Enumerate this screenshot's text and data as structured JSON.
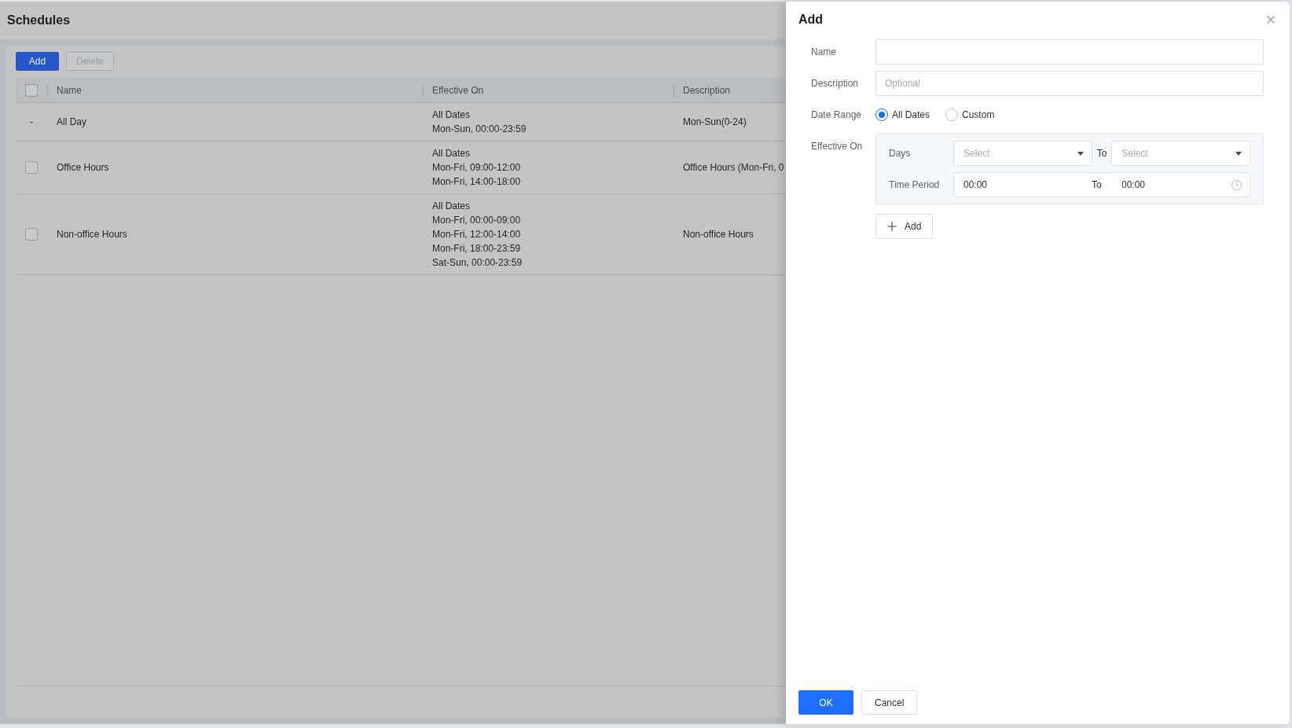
{
  "page": {
    "title": "Schedules",
    "toolbar": [
      {
        "label": "Add",
        "kind": "primary",
        "disabled": false
      },
      {
        "label": "Delete",
        "kind": "default",
        "disabled": true
      }
    ],
    "table": {
      "header_checkbox": {
        "checked": false
      },
      "columns": [
        "Name",
        "Effective On",
        "Description"
      ],
      "rows": [
        {
          "select": {
            "kind": "text",
            "text": "-"
          },
          "name": "All Day",
          "effective_on": [
            "All Dates",
            "Mon-Sun, 00:00-23:59"
          ],
          "description": "Mon-Sun(0-24)"
        },
        {
          "select": {
            "kind": "checkbox",
            "checked": false
          },
          "name": "Office Hours",
          "effective_on": [
            "All Dates",
            "Mon-Fri, 09:00-12:00",
            "Mon-Fri, 14:00-18:00"
          ],
          "description": "Office Hours (Mon-Fri, 0"
        },
        {
          "select": {
            "kind": "checkbox",
            "checked": false
          },
          "name": "Non-office Hours",
          "effective_on": [
            "All Dates",
            "Mon-Fri, 00:00-09:00",
            "Mon-Fri, 12:00-14:00",
            "Mon-Fri, 18:00-23:59",
            "Sat-Sun, 00:00-23:59"
          ],
          "description": "Non-office Hours"
        }
      ]
    }
  },
  "drawer": {
    "title": "Add",
    "fields": [
      {
        "kind": "text",
        "label": "Name"
      },
      {
        "kind": "text",
        "label": "Description",
        "placeholder": "Optional"
      },
      {
        "kind": "radio",
        "label": "Date Range",
        "options": [
          {
            "label": "All Dates",
            "selected": true
          },
          {
            "label": "Custom",
            "selected": false
          }
        ]
      },
      {
        "kind": "periods",
        "label": "Effective On",
        "days": {
          "label": "Days",
          "start": {
            "placeholder": "Select"
          },
          "separator": "To",
          "end": {
            "placeholder": "Select"
          }
        },
        "time_period": {
          "label": "Time Period",
          "start": "00:00",
          "separator": "To",
          "end": "00:00"
        },
        "add_button": "Add"
      }
    ],
    "buttons": [
      {
        "label": "OK",
        "kind": "primary"
      },
      {
        "label": "Cancel",
        "kind": "default"
      }
    ]
  }
}
